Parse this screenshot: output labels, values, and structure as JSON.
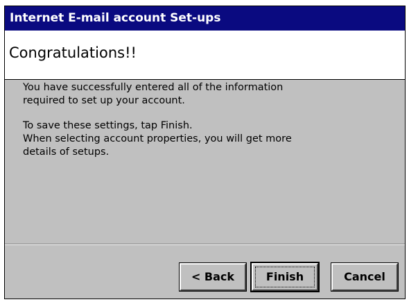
{
  "window": {
    "title": "Internet E-mail account Set-ups"
  },
  "header": {
    "title": "Congratulations!!"
  },
  "body": {
    "message_1": "You have successfully entered all of the information\nrequired to set up your account.",
    "message_2": "To save these settings, tap Finish.\nWhen selecting account properties, you will get more\ndetails of setups."
  },
  "buttons": {
    "back_label": "< Back",
    "finish_label": "Finish",
    "cancel_label": "Cancel"
  },
  "colors": {
    "titlebar_bg": "#0a0a80",
    "dialog_bg": "#c0c0c0",
    "header_bg": "#ffffff"
  }
}
